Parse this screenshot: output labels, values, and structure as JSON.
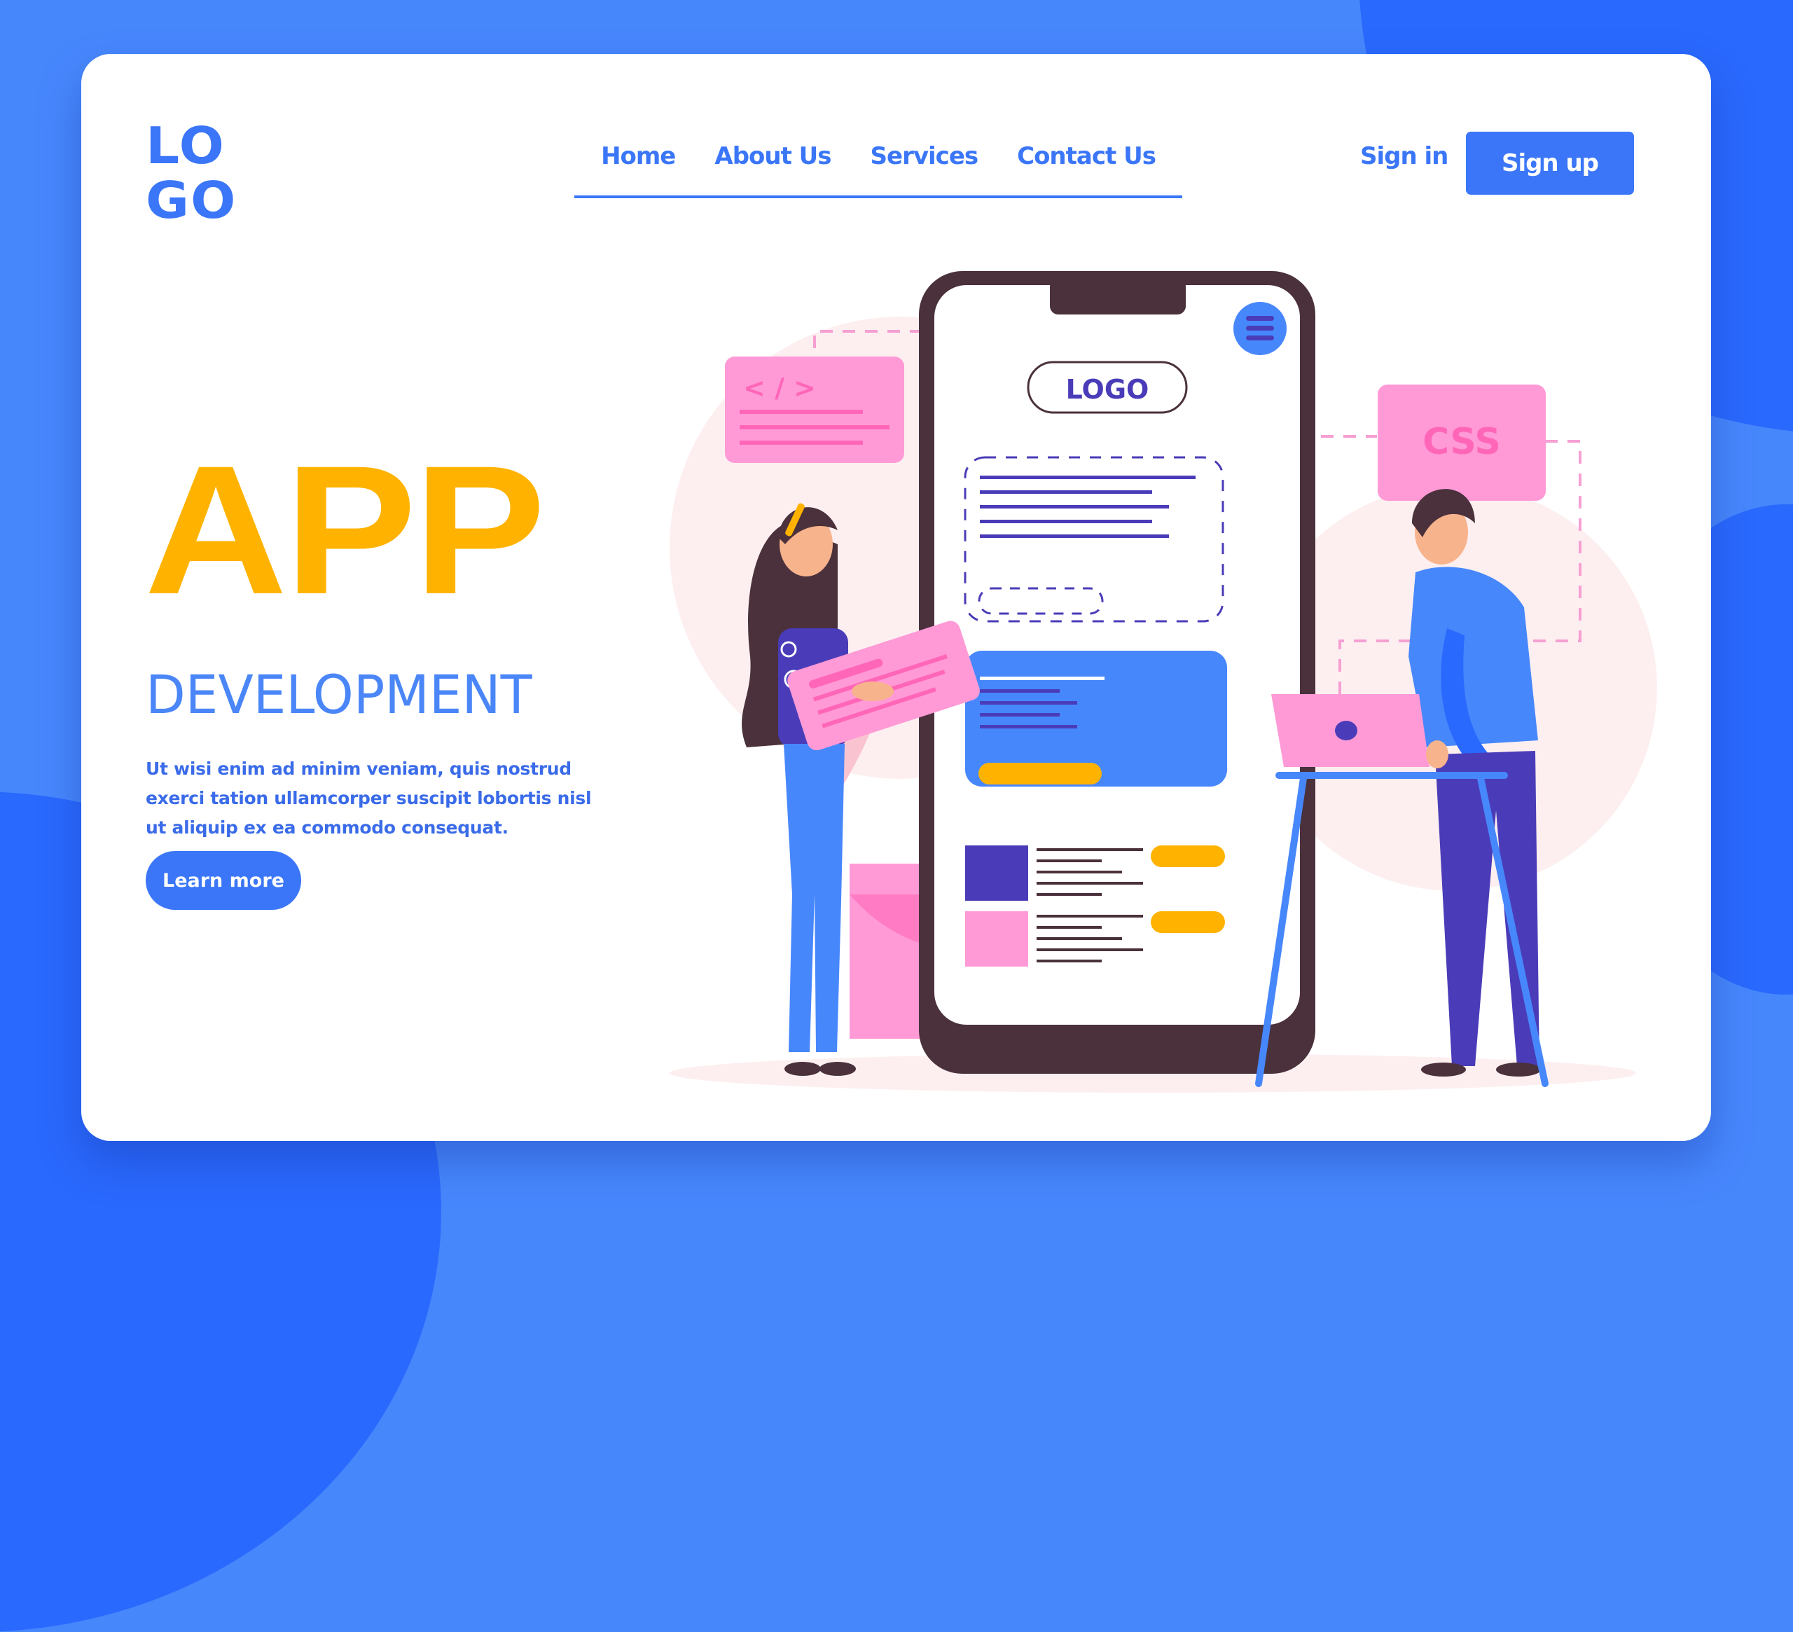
{
  "colors": {
    "background": "#4787fc",
    "background_dark": "#2a69fd",
    "primary": "#3a76f7",
    "accent_yellow": "#ffb300",
    "pink": "#ff9ad6",
    "pink_dark": "#ff66b8",
    "indigo": "#4a3cb8",
    "phone_frame": "#4a313c"
  },
  "header": {
    "logo_line1": "LO",
    "logo_line2": "GO",
    "nav": [
      {
        "label": "Home"
      },
      {
        "label": "About Us"
      },
      {
        "label": "Services"
      },
      {
        "label": "Contact Us"
      }
    ],
    "sign_in": "Sign in",
    "sign_up": "Sign up"
  },
  "hero": {
    "title": "APP",
    "subtitle": "DEVELOPMENT",
    "description": "Ut wisi enim ad minim veniam, quis nostrud exerci tation ullamcorper suscipit lobortis nisl ut aliquip ex ea commodo consequat.",
    "cta": "Learn more"
  },
  "illustration": {
    "phone_logo": "LOGO",
    "code_card_glyph": "< / >",
    "css_card_label": "CSS"
  }
}
